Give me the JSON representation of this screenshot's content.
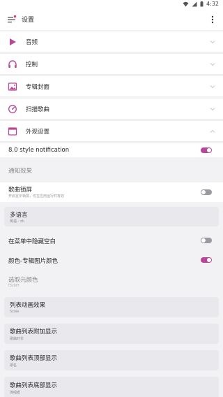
{
  "status_bar": {
    "time": "4:32"
  },
  "app_bar": {
    "title": "设置"
  },
  "sections": [
    {
      "label": "音频",
      "icon": "play-icon"
    },
    {
      "label": "控制",
      "icon": "headphones-icon"
    },
    {
      "label": "专辑封面",
      "icon": "image-icon"
    },
    {
      "label": "扫描歌曲",
      "icon": "scan-icon"
    },
    {
      "label": "外观设置",
      "icon": "window-icon"
    }
  ],
  "appearance": {
    "notification_style": {
      "label": "8.0 style notification",
      "enabled": true
    },
    "notification_effect": {
      "label": "通知效果"
    },
    "lyrics_lockscreen": {
      "label": "歌曲锁屏",
      "subtitle": "开启显示锁屏，仅在应用运行时有效",
      "enabled": false
    },
    "language": {
      "label": "多语言",
      "value": "英语 - zh"
    },
    "hide_empty_menu": {
      "label": "在菜单中隐藏空白",
      "enabled": false
    },
    "color_album": {
      "label": "颜色-专辑图片颜色",
      "enabled": true
    },
    "element_color": {
      "label": "选取元颜色",
      "value": "f3c6f7"
    },
    "list_animation": {
      "label": "列表动画效果",
      "value": "Scale"
    },
    "list_extra": {
      "label": "歌曲列表附加显示",
      "value": "歌曲时长"
    },
    "list_top": {
      "label": "歌曲列表顶部显示",
      "value": "歌名"
    },
    "list_bottom": {
      "label": "歌曲列表底部显示",
      "value": "演唱者"
    }
  },
  "colors": {
    "accent": "#b8479a",
    "toggle_off": "#9a9aa0",
    "card_bg": "#e8e8ed",
    "page_bg": "#f2f2f5"
  }
}
